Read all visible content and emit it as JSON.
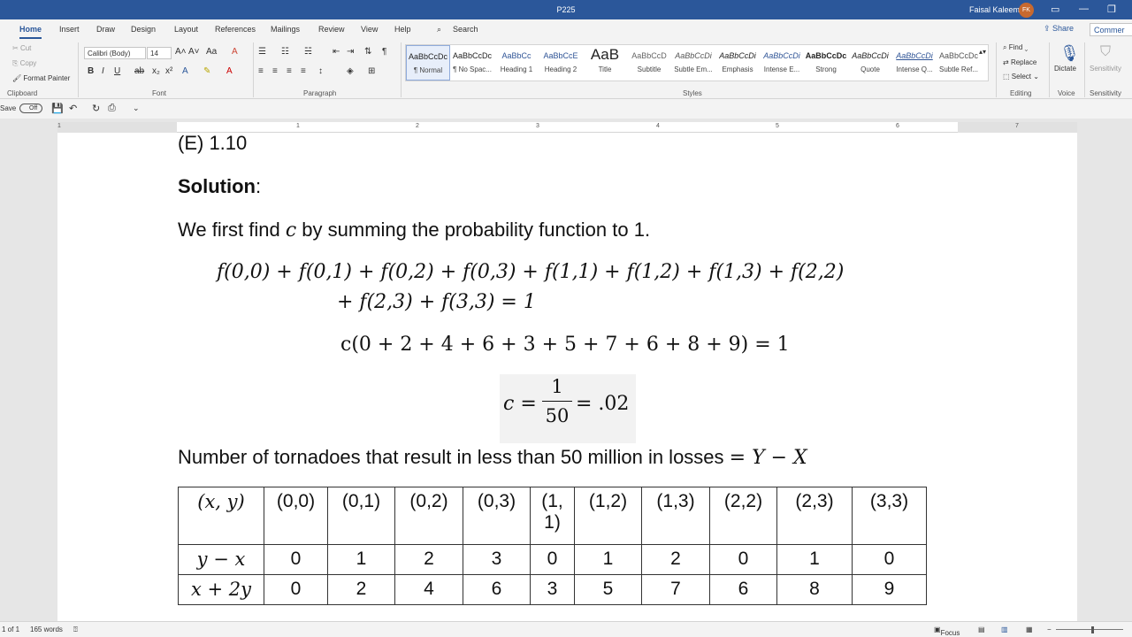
{
  "titlebar": {
    "doc_title": "P225",
    "user_name": "Faisal Kaleem",
    "user_initials": "FK"
  },
  "tabs": [
    "Home",
    "Insert",
    "Draw",
    "Design",
    "Layout",
    "References",
    "Mailings",
    "Review",
    "View",
    "Help"
  ],
  "search_label": "Search",
  "share_label": "Share",
  "comments_label": "Commer",
  "ribbon": {
    "clipboard": {
      "cut": "Cut",
      "copy": "Copy",
      "format_painter": "Format Painter",
      "label": "Clipboard"
    },
    "font": {
      "name": "Calibri (Body)",
      "size": "14",
      "label": "Font"
    },
    "paragraph_label": "Paragraph",
    "styles_label": "Styles",
    "styles": [
      {
        "sample": "AaBbCcDc",
        "name": "¶ Normal"
      },
      {
        "sample": "AaBbCcDc",
        "name": "¶ No Spac..."
      },
      {
        "sample": "AaBbCc",
        "name": "Heading 1"
      },
      {
        "sample": "AaBbCcE",
        "name": "Heading 2"
      },
      {
        "sample": "AaB",
        "name": "Title"
      },
      {
        "sample": "AaBbCcD",
        "name": "Subtitle"
      },
      {
        "sample": "AaBbCcDi",
        "name": "Subtle Em..."
      },
      {
        "sample": "AaBbCcDi",
        "name": "Emphasis"
      },
      {
        "sample": "AaBbCcDi",
        "name": "Intense E..."
      },
      {
        "sample": "AaBbCcDc",
        "name": "Strong"
      },
      {
        "sample": "AaBbCcDi",
        "name": "Quote"
      },
      {
        "sample": "AaBbCcDi",
        "name": "Intense Q..."
      },
      {
        "sample": "AaBbCcDc",
        "name": "Subtle Ref..."
      }
    ],
    "editing": {
      "find": "Find",
      "replace": "Replace",
      "select": "Select",
      "label": "Editing"
    },
    "voice": {
      "dictate": "Dictate",
      "label": "Voice"
    },
    "sensitivity": {
      "button": "Sensitivity",
      "label": "Sensitivity"
    }
  },
  "qat": {
    "autosave_label": "Save",
    "autosave_state": "Off"
  },
  "ruler_numbers": [
    "1",
    "1",
    "2",
    "3",
    "4",
    "5",
    "6",
    "7"
  ],
  "document": {
    "answer_e": "(E) 1.10",
    "solution_label": "Solution",
    "solution_colon": ":",
    "intro_before": "We first find ",
    "intro_var": "c",
    "intro_after": " by summing the probability function to 1.",
    "eq1_line1": "f(0,0) + f(0,1) + f(0,2) + f(0,3) + f(1,1) + f(1,2) + f(1,3) + f(2,2)",
    "eq1_line2": "+ f(2,3) + f(3,3) = 1",
    "eq2": "c(0 + 2 + 4 + 6 + 3 + 5 + 7 + 6 + 8 + 9) = 1",
    "eq3_lhs": "c =",
    "eq3_num": "1",
    "eq3_den": "50",
    "eq3_rhs": "= .02",
    "tornado_text": "Number of tornadoes that result in less than 50 million in losses ",
    "tornado_math": "= Y − X",
    "table": {
      "header": [
        "(x, y)",
        "(0,0)",
        "(0,1)",
        "(0,2)",
        "(0,3)",
        "(1,\n1)",
        "(1,2)",
        "(1,3)",
        "(2,2)",
        "(2,3)",
        "(3,3)"
      ],
      "rows": [
        [
          "y − x",
          "0",
          "1",
          "2",
          "3",
          "0",
          "1",
          "2",
          "0",
          "1",
          "0"
        ],
        [
          "x + 2y",
          "0",
          "2",
          "4",
          "6",
          "3",
          "5",
          "7",
          "6",
          "8",
          "9"
        ]
      ]
    }
  },
  "status": {
    "page": "1 of 1",
    "words": "165 words",
    "focus": "Focus"
  }
}
